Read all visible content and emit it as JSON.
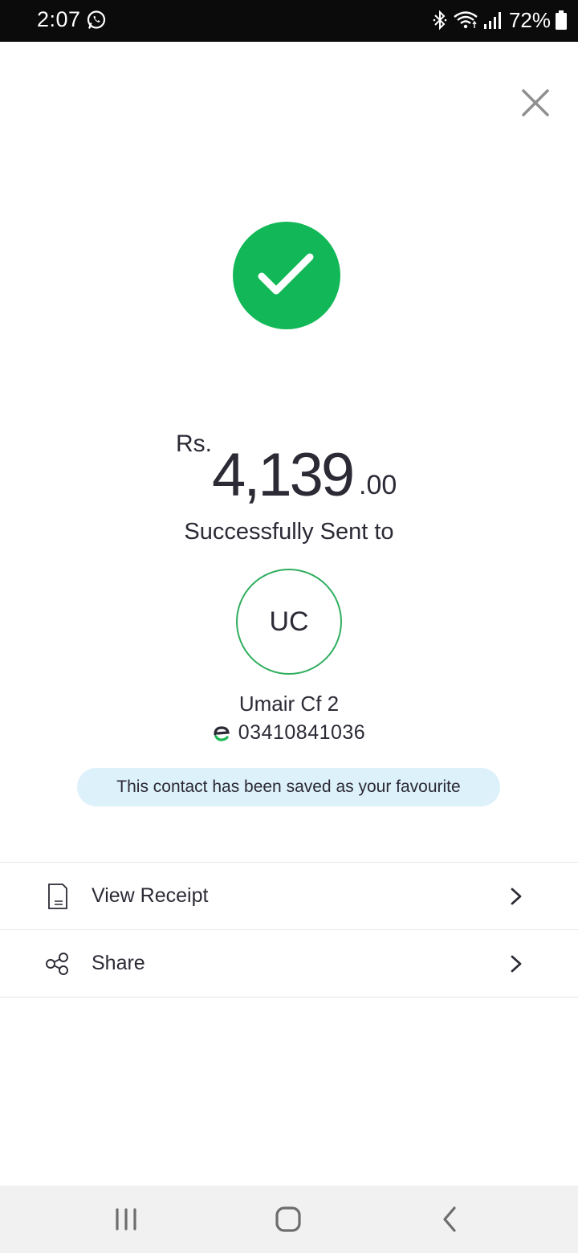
{
  "status_bar": {
    "time": "2:07",
    "battery": "72%",
    "icons": [
      "whatsapp-icon",
      "bluetooth-icon",
      "wifi-icon",
      "signal-icon",
      "battery-icon"
    ]
  },
  "close_icon": "close-icon",
  "success_icon": "check-circle-icon",
  "amount": {
    "currency": "Rs.",
    "whole": "4,139",
    "decimal": ".00"
  },
  "title": "Successfully Sent to",
  "contact": {
    "initials": "UC",
    "name": "Umair Cf 2",
    "phone": "03410841036"
  },
  "favourite_message": "This contact has been saved as your favourite",
  "actions": [
    {
      "label": "View Receipt",
      "icon": "receipt-icon"
    },
    {
      "label": "Share",
      "icon": "share-icon"
    }
  ],
  "colors": {
    "success_green": "#12b857",
    "avatar_border": "#2fae5e",
    "banner_bg": "#ddf1fb",
    "text_dark": "#2b2a35"
  }
}
